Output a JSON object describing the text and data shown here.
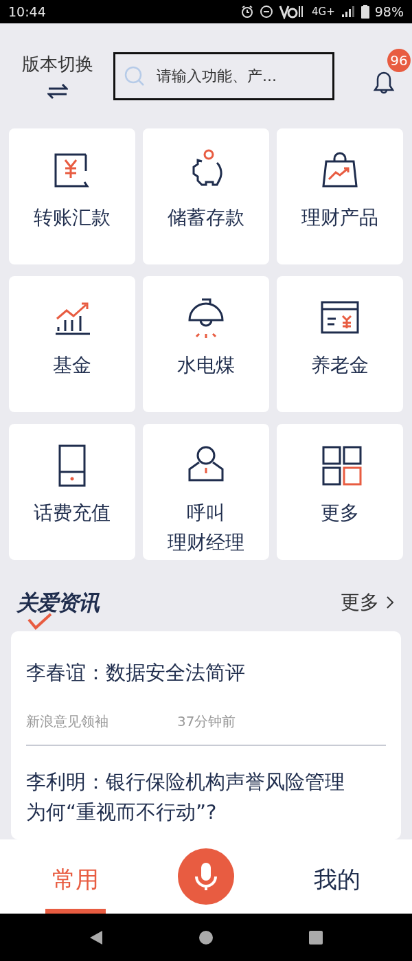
{
  "status_bar": {
    "time": "10:44",
    "network": "4G+",
    "battery": "98%"
  },
  "header": {
    "switch_label": "版本切换",
    "search": {
      "placeholder": "请输入功能、产..."
    },
    "notification_count": "96"
  },
  "services": [
    {
      "lines": [
        "转账汇款"
      ]
    },
    {
      "lines": [
        "储蓄存款"
      ]
    },
    {
      "lines": [
        "理财产品"
      ]
    },
    {
      "lines": [
        "基金"
      ]
    },
    {
      "lines": [
        "水电煤"
      ]
    },
    {
      "lines": [
        "养老金"
      ]
    },
    {
      "lines": [
        "话费充值"
      ]
    },
    {
      "lines": [
        "呼叫",
        "理财经理"
      ]
    },
    {
      "lines": [
        "更多"
      ]
    }
  ],
  "news": {
    "title": "关爱资讯",
    "more": "更多",
    "items": [
      {
        "title": "李春谊：数据安全法简评",
        "source": "新浪意见领袖",
        "time": "37分钟前"
      },
      {
        "title": "李利明：银行保险机构声誉风险管理为何“重视而不行动”?"
      }
    ]
  },
  "tabs": [
    {
      "label": "常用",
      "selected": true
    },
    {
      "kind": "mic"
    },
    {
      "label": "我的",
      "selected": false
    }
  ]
}
